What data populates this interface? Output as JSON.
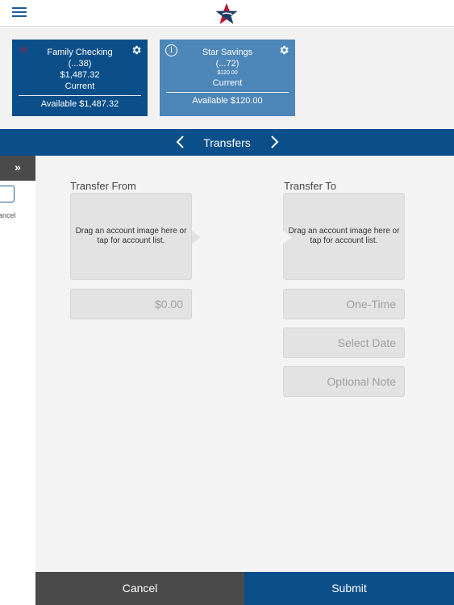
{
  "header": {
    "menu_icon": "hamburger-menu-icon",
    "logo_icon": "star-logo-icon"
  },
  "accounts": [
    {
      "name": "Family Checking",
      "number": "(...38)",
      "balance": "$1,487.32",
      "status": "Current",
      "available": "Available $1,487.32",
      "color": "#0b4f8a"
    },
    {
      "name": "Star Savings",
      "number": "(...72)",
      "balance": "$120.00",
      "status": "Current",
      "available": "Available $120.00",
      "color": "#4d86b9"
    }
  ],
  "nav": {
    "title": "Transfers"
  },
  "sidepanel": {
    "expand_label": "»",
    "cancel_label": "ancel"
  },
  "transfer": {
    "from_label": "Transfer From",
    "to_label": "Transfer To",
    "from_drop_text": "Drag an account image here or tap for account list.",
    "to_drop_text": "Drag an account image here or tap for account list.",
    "amount_placeholder": "$0.00",
    "frequency_placeholder": "One-Time",
    "date_placeholder": "Select Date",
    "note_placeholder": "Optional Note"
  },
  "footer": {
    "cancel_label": "Cancel",
    "submit_label": "Submit"
  },
  "colors": {
    "brand_blue": "#0b4f8a",
    "light_blue": "#4d86b9",
    "dark_gray": "#4a4a4a"
  }
}
